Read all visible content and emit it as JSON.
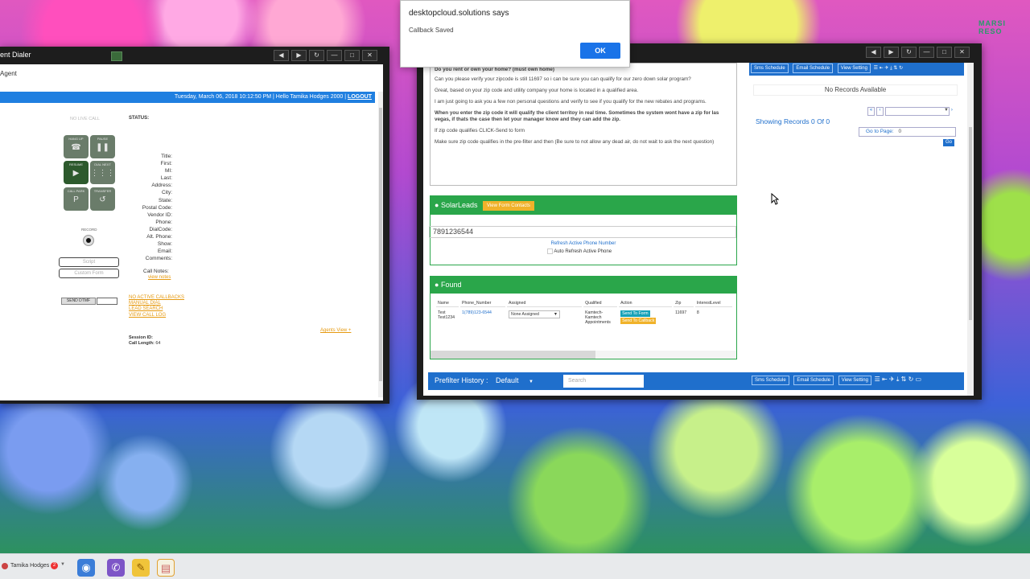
{
  "dialer": {
    "title": "ent Dialer",
    "tab_agent": "Agent",
    "status_line": "Tuesday, March 06, 2018 10:12:50 PM | Hello Tamika Hodges 2000 |",
    "logout": "LOGOUT",
    "no_live_call": "NO LIVE CALL",
    "status_label": "STATUS:",
    "controls": [
      "HANG UP",
      "PAUSE",
      "RESUME",
      "DIAL NEXT",
      "CALL PARK",
      "TRANSFER"
    ],
    "record_label": "RECORD",
    "fields": [
      "Title:",
      "First:",
      "MI:",
      "Last:",
      "Address:",
      "City:",
      "State:",
      "Postal Code:",
      "Vendor ID:",
      "Phone:",
      "DialCode:",
      "Alt. Phone:",
      "Show:",
      "Email:",
      "Comments:"
    ],
    "script_btn": "Script",
    "custom_form_btn": "Custom Form",
    "call_notes_label": "Call Notes:",
    "view_notes": "view notes",
    "send_dtmf": "SEND DTMF",
    "links": [
      "NO ACTIVE CALLBACKS",
      "MANUAL DIAL",
      "LEAD SEARCH",
      "VIEW CALL LOG"
    ],
    "agents_view": "Agents View +",
    "session_id_label": "Session ID:",
    "call_length_label": "Call Length:",
    "call_length_value": "64"
  },
  "dialog": {
    "origin": "desktopcloud.solutions says",
    "message": "Callback Saved",
    "ok": "OK"
  },
  "browser": {
    "script_lines": [
      "Do you rent or own your home? (must own home)",
      "Can you please verify your zipcode is still 11697 so i can be sure you can qualify for our zero down solar program?",
      "Great, based on your zip code and utility company your home is  located in a qualified area.",
      " I am just going to ask you a few non personal questions and verify to see if you qualify for the new rebates and programs.",
      "When you enter the zip code it will qualify the client territoy in real time. Sometimes the system wont have a zip for las vegas, if thats the case then let your manager know and they can add the zip.",
      "If zip code qualifies CLICK-Send to form",
      "Make sure zip code qualifies in the pre-filter and then (Be sure to not allow any dead air, do not wait to ask the next question)"
    ],
    "solar_title": "SolarLeads",
    "view_form_contacts": "View Form Contacts",
    "phone_value": "7891236544",
    "refresh_active_phone": "Refresh Active Phone Number",
    "auto_refresh": "Auto Refresh Active Phone",
    "found_title": "Found",
    "table_headers": [
      "Name",
      "Phone_Number",
      "Assigned",
      "Qualified",
      "Action",
      "Zip",
      "InterestLevel"
    ],
    "row": {
      "name": "Test Test1234",
      "phone": "1(789)123-6544",
      "assigned": "None Assigned",
      "qualified": "Kamtech-Kamtech Appointments",
      "send_form": "Send To Form",
      "send_callback": "Send To Callback",
      "zip": "11697",
      "interest": "8"
    },
    "right_buttons": [
      "Sms Schedule",
      "Email Schedule",
      "View Setting"
    ],
    "no_records": "No Records Available",
    "showing_records": "Showing Records 0 Of 0",
    "go_to_page": "Go to Page:",
    "go_to_page_value": "0",
    "go": "Go",
    "prefilter_title": "Prefilter History :",
    "prefilter_value": "Default",
    "search_placeholder": "Search"
  },
  "taskbar": {
    "user": "Tamika Hodges",
    "badge": "2"
  },
  "wallpaper_logo": "MARSI RESO"
}
